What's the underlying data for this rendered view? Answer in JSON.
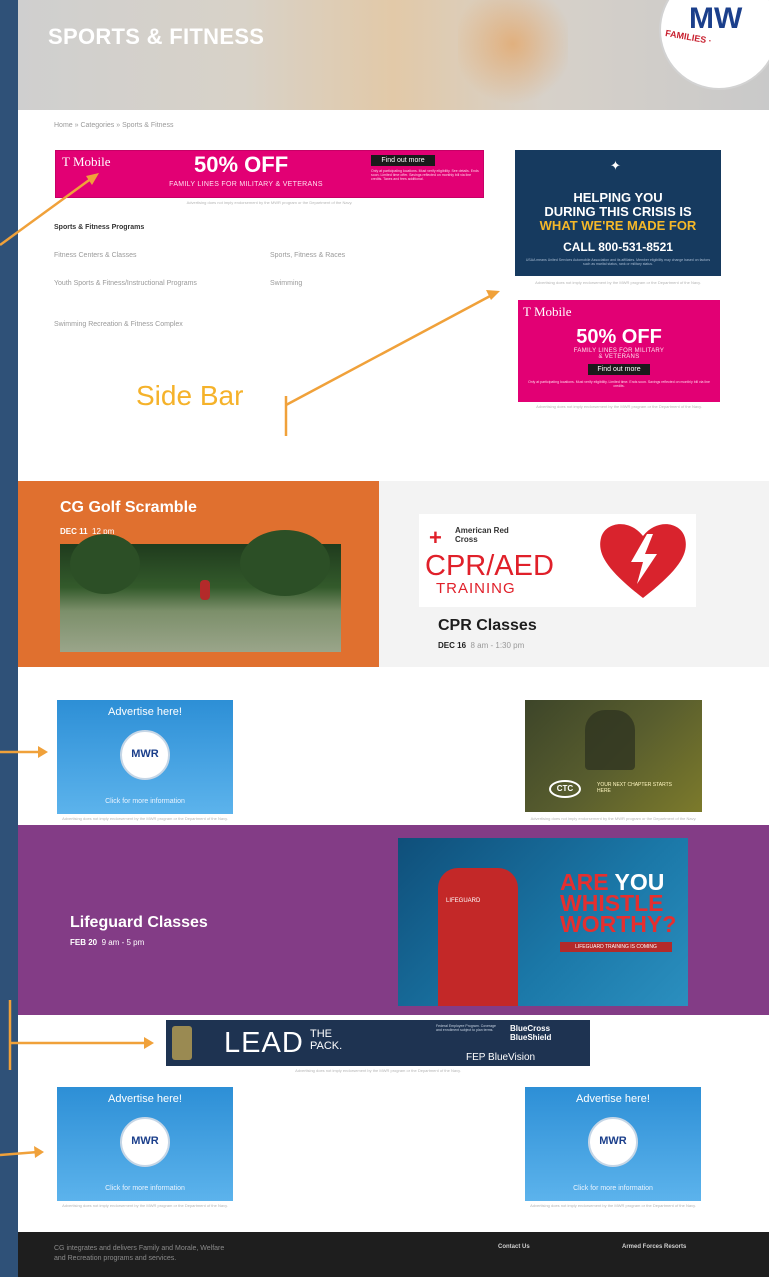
{
  "hero": {
    "title": "SPORTS & FITNESS"
  },
  "logo": {
    "text": "MW",
    "ring_text": "FAMILIES ·"
  },
  "breadcrumb": {
    "text": "Home  »  Categories  »  Sports & Fitness"
  },
  "ads": {
    "tmobile_top": {
      "brand": "T Mobile",
      "headline": "50% OFF",
      "subline": "FAMILY LINES FOR MILITARY & VETERANS",
      "button": "Find out more",
      "fine_print": "Only at participating locations. Must verify eligibility. See details. Ends soon. Limited time offer. Savings reflected on monthly bill via line credits. Taxes and fees additional."
    },
    "usaa": {
      "line1": "HELPING YOU",
      "line2": "DURING THIS CRISIS IS",
      "line3": "WHAT WE'RE MADE FOR",
      "call": "CALL 800-531-8521",
      "fine_print": "USAA means United Services Automobile Association and its affiliates. Member eligibility may change based on factors such as marital status, rank or military status."
    },
    "tmobile_side": {
      "brand": "T Mobile",
      "headline": "50% OFF",
      "subline": "FAMILY LINES FOR MILITARY & VETERANS",
      "button": "Find out more",
      "fine_print": "Only at participating locations. Must verify eligibility. Limited time. Ends soon. Savings reflected on monthly bill via line credits."
    },
    "mwr_advertise": {
      "title": "Advertise here!",
      "globe": "MWR",
      "info": "Click for more information"
    },
    "ctc": {
      "badge": "CTC",
      "text": "YOUR NEXT CHAPTER STARTS HERE"
    },
    "whistle": {
      "line1a": "ARE",
      "line1b": "YOU",
      "line2": "WHISTLE",
      "line3": "WORTHY?",
      "strip": "LIFEGUARD TRAINING IS COMING",
      "shirt": "LIFEGUARD"
    },
    "bcbs": {
      "lead": "LEAD",
      "pack_1": "THE",
      "pack_2": "PACK.",
      "fine_print": "Federal Employee Program. Coverage and enrollment subject to plan terms.",
      "logo_1": "BlueCross",
      "logo_2": "BlueShield",
      "fep": "FEP BlueVision",
      "fep_tag": "FEP"
    },
    "caption": "Advertising does not imply endorsement by the MWR program or the Department of the Navy."
  },
  "programs": {
    "title": "Sports & Fitness Programs",
    "links": [
      "Fitness Centers & Classes",
      "Sports, Fitness & Races",
      "Youth Sports & Fitness/Instructional Programs",
      "Swimming",
      "Swimming Recreation & Fitness Complex"
    ]
  },
  "annotation": {
    "sidebar_label": "Side Bar"
  },
  "events": {
    "golf": {
      "title": "CG Golf Scramble",
      "date": "DEC 11",
      "time": "12 pm"
    },
    "cpr": {
      "title": "CPR Classes",
      "date": "DEC 16",
      "time": "8 am - 1:30 pm",
      "image_org": "American Red Cross",
      "image_big": "CPR/AED",
      "image_sub": "TRAINING"
    },
    "lifeguard": {
      "title": "Lifeguard Classes",
      "date": "FEB 20",
      "time": "9 am - 5 pm"
    }
  },
  "footer": {
    "text_line1": "CG integrates and delivers Family and Morale, Welfare",
    "text_line2": "and Recreation programs and services.",
    "col1": "Contact Us",
    "col2": "Armed Forces Resorts"
  },
  "colors": {
    "orange_annotation": "#f0a13a",
    "golf_bg": "#e0702f",
    "lifeguard_bg": "#833c86",
    "tmobile": "#e20074",
    "usaa": "#163a5f",
    "sidebar_label": "#f5b22a"
  }
}
